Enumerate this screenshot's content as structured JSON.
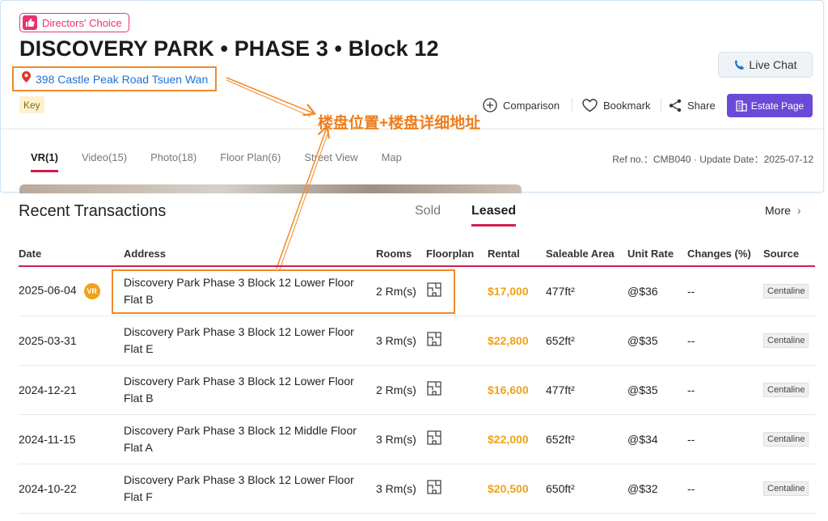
{
  "header": {
    "badge": "Directors' Choice",
    "title": "DISCOVERY PARK • PHASE 3 • Block 12",
    "address": "398 Castle Peak Road Tsuen Wan",
    "key_tag": "Key",
    "live_chat": "Live Chat",
    "actions": {
      "comparison": "Comparison",
      "bookmark": "Bookmark",
      "share": "Share",
      "estate_page": "Estate Page"
    },
    "tabs": [
      "VR(1)",
      "Video(15)",
      "Photo(18)",
      "Floor Plan(6)",
      "Street View",
      "Map"
    ],
    "ref": "Ref no.：CMB040 · Update Date：2025-07-12"
  },
  "annotation": "楼盘位置+楼盘详细地址",
  "transactions": {
    "title": "Recent Transactions",
    "tabs": [
      "Sold",
      "Leased"
    ],
    "more": "More",
    "columns": [
      "Date",
      "Address",
      "Rooms",
      "Floorplan",
      "Rental",
      "Saleable Area",
      "Unit Rate",
      "Changes (%)",
      "Source"
    ],
    "rows": [
      {
        "date": "2025-06-04",
        "vr": "VR",
        "address": "Discovery Park Phase 3 Block 12 Lower Floor Flat B",
        "rooms": "2 Rm(s)",
        "rental": "$17,000",
        "area": "477ft²",
        "rate": "@$36",
        "changes": "--",
        "source": "Centaline"
      },
      {
        "date": "2025-03-31",
        "vr": "",
        "address": "Discovery Park Phase 3 Block 12 Lower Floor Flat E",
        "rooms": "3 Rm(s)",
        "rental": "$22,800",
        "area": "652ft²",
        "rate": "@$35",
        "changes": "--",
        "source": "Centaline"
      },
      {
        "date": "2024-12-21",
        "vr": "",
        "address": "Discovery Park Phase 3 Block 12 Lower Floor Flat B",
        "rooms": "2 Rm(s)",
        "rental": "$16,600",
        "area": "477ft²",
        "rate": "@$35",
        "changes": "--",
        "source": "Centaline"
      },
      {
        "date": "2024-11-15",
        "vr": "",
        "address": "Discovery Park Phase 3 Block 12 Middle Floor Flat A",
        "rooms": "3 Rm(s)",
        "rental": "$22,000",
        "area": "652ft²",
        "rate": "@$34",
        "changes": "--",
        "source": "Centaline"
      },
      {
        "date": "2024-10-22",
        "vr": "",
        "address": "Discovery Park Phase 3 Block 12 Lower Floor Flat F",
        "rooms": "3 Rm(s)",
        "rental": "$20,500",
        "area": "650ft²",
        "rate": "@$32",
        "changes": "--",
        "source": "Centaline"
      }
    ]
  },
  "colors": {
    "accent": "#d0204f",
    "link": "#1f72d6",
    "rental": "#f0a21a",
    "annotation": "#f07d1b",
    "estate_button": "#6b4ad8"
  }
}
